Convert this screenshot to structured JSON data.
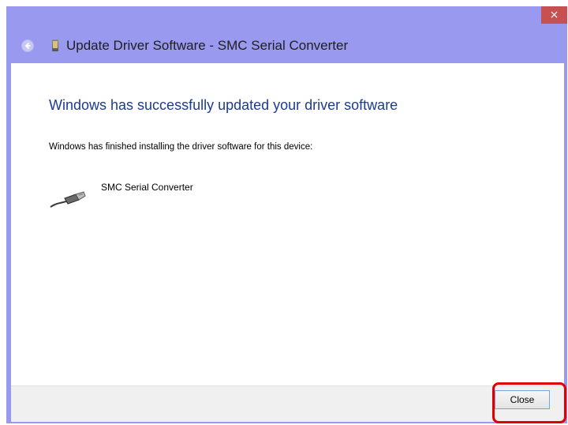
{
  "window": {
    "title": "Update Driver Software - SMC Serial Converter",
    "close_glyph": "×"
  },
  "content": {
    "heading": "Windows has successfully updated your driver software",
    "info": "Windows has finished installing the driver software for this device:",
    "device_name": "SMC Serial Converter",
    "device_icon": "usb-plug-icon"
  },
  "footer": {
    "close_label": "Close"
  },
  "colors": {
    "titlebar": "#9999f0",
    "heading": "#1c3b94",
    "close_x": "#c75050",
    "highlight": "#e00000"
  }
}
